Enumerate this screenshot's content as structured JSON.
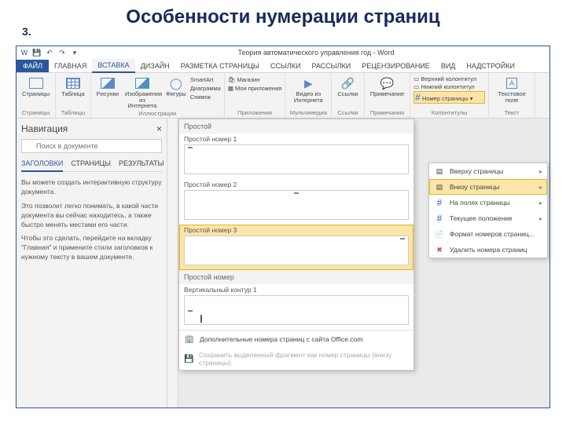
{
  "slide": {
    "title": "Особенности нумерации страниц",
    "number": "3."
  },
  "titlebar": {
    "doc": "Теория автоматического управления год - Word"
  },
  "tabs": {
    "file": "ФАЙЛ",
    "items": [
      "ГЛАВНАЯ",
      "ВСТАВКА",
      "ДИЗАЙН",
      "РАЗМЕТКА СТРАНИЦЫ",
      "ССЫЛКИ",
      "РАССЫЛКИ",
      "РЕЦЕНЗИРОВАНИЕ",
      "ВИД",
      "НАДСТРОЙКИ"
    ],
    "active": 1
  },
  "ribbon": {
    "groups": [
      {
        "title": "Страницы",
        "buttons": [
          {
            "label": "Страницы"
          }
        ]
      },
      {
        "title": "Таблицы",
        "buttons": [
          {
            "label": "Таблица"
          }
        ]
      },
      {
        "title": "Иллюстрации",
        "buttons": [
          {
            "label": "Рисунки"
          },
          {
            "label": "Изображения из Интернета"
          },
          {
            "label": "Фигуры"
          }
        ],
        "extras": [
          "SmartArt",
          "Диаграмма",
          "Снимок"
        ]
      },
      {
        "title": "Приложения",
        "buttons": [
          {
            "label": "Магазин"
          },
          {
            "label": "Мои приложения"
          }
        ]
      },
      {
        "title": "Мультимедиа",
        "buttons": [
          {
            "label": "Видео из Интернета"
          }
        ]
      },
      {
        "title": "Ссылки",
        "buttons": [
          {
            "label": "Ссылки"
          }
        ]
      },
      {
        "title": "Примечания",
        "buttons": [
          {
            "label": "Примечание"
          }
        ]
      },
      {
        "title": "Колонтитулы",
        "buttons": [
          {
            "label": "Верхний колонтитул"
          },
          {
            "label": "Нижний колонтитул"
          },
          {
            "label": "Номер страницы"
          }
        ]
      },
      {
        "title": "Текст",
        "buttons": [
          {
            "label": "Текстовое поле"
          }
        ]
      }
    ]
  },
  "nav": {
    "title": "Навигация",
    "search_placeholder": "Поиск в документе",
    "tabs": [
      "ЗАГОЛОВКИ",
      "СТРАНИЦЫ",
      "РЕЗУЛЬТАТЫ"
    ],
    "body": [
      "Вы можете создать интерактивную структуру документа.",
      "Это позволит легко понимать, в какой части документа вы сейчас находитесь, а также быстро менять местами его части.",
      "Чтобы это сделать, перейдите на вкладку \"Главная\" и примените стили заголовков к нужному тексту в вашем документе."
    ]
  },
  "gallery": {
    "sections": [
      {
        "header": "Простой",
        "items": [
          {
            "label": "Простой номер 1",
            "pos": "left"
          },
          {
            "label": "Простой номер 2",
            "pos": "center"
          },
          {
            "label": "Простой номер 3",
            "pos": "right",
            "selected": true
          }
        ]
      },
      {
        "header": "Простой номер",
        "items": [
          {
            "label": "Вертикальный контур 1",
            "pos": "vbar"
          }
        ]
      }
    ],
    "footer": [
      {
        "icon": "office",
        "label": "Дополнительные номера страниц с сайта Office.com"
      },
      {
        "icon": "save",
        "label": "Сохранить выделенный фрагмент как номер страницы (внизу страницы)",
        "disabled": true
      }
    ]
  },
  "pagenum_menu": {
    "items": [
      {
        "icon": "top",
        "label": "Вверху страницы",
        "arrow": true
      },
      {
        "icon": "bottom",
        "label": "Внизу страницы",
        "arrow": true,
        "selected": true
      },
      {
        "icon": "margin",
        "label": "На полях страницы",
        "arrow": true
      },
      {
        "icon": "current",
        "label": "Текущее положение",
        "arrow": true
      },
      {
        "icon": "format",
        "label": "Формат номеров страниц..."
      },
      {
        "icon": "remove",
        "label": "Удалить номера страниц"
      }
    ]
  }
}
